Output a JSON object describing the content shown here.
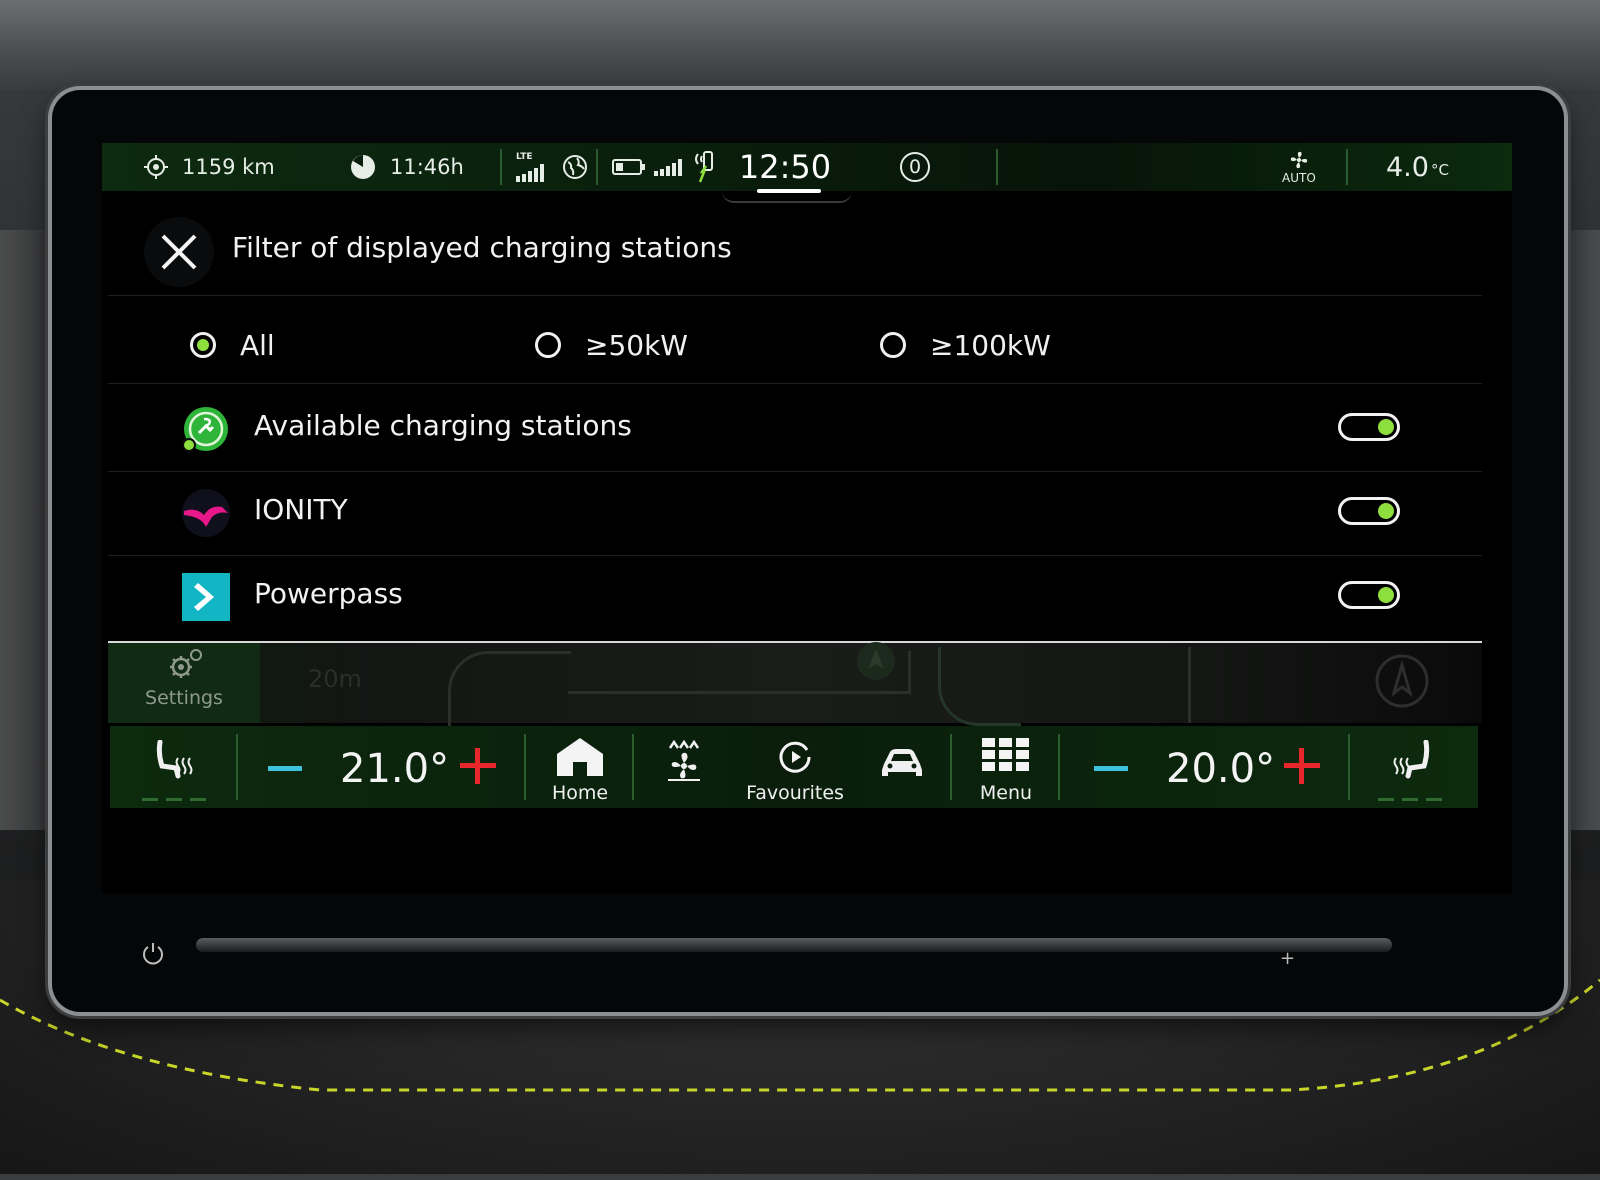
{
  "status_bar": {
    "range": "1159 km",
    "charge_time": "11:46h",
    "network": "LTE",
    "clock": "12:50",
    "notification_count": "0",
    "fan_mode": "AUTO",
    "outside_temp": "4.0",
    "outside_temp_unit": "°C"
  },
  "header": {
    "title": "Filter of displayed charging stations"
  },
  "power_filter": {
    "options": [
      "All",
      "≥50kW",
      "≥100kW"
    ],
    "selected": "All"
  },
  "providers": [
    {
      "label": "Available charging stations",
      "icon": "charging-station-icon",
      "enabled": true
    },
    {
      "label": "IONITY",
      "icon": "ionity-logo-icon",
      "enabled": true
    },
    {
      "label": "Powerpass",
      "icon": "powerpass-logo-icon",
      "enabled": true
    }
  ],
  "map_strip": {
    "settings_label": "Settings",
    "scale_label": "20m"
  },
  "climate_bar": {
    "left_temp": "21.0°",
    "right_temp": "20.0°",
    "home_label": "Home",
    "favourites_label": "Favourites",
    "menu_label": "Menu"
  },
  "colors": {
    "accent_green": "#8ede3e",
    "minus_cyan": "#3ec1dd",
    "plus_red": "#e8262b",
    "ionity_pink": "#e8178a",
    "powerpass_teal": "#12b5c4"
  }
}
